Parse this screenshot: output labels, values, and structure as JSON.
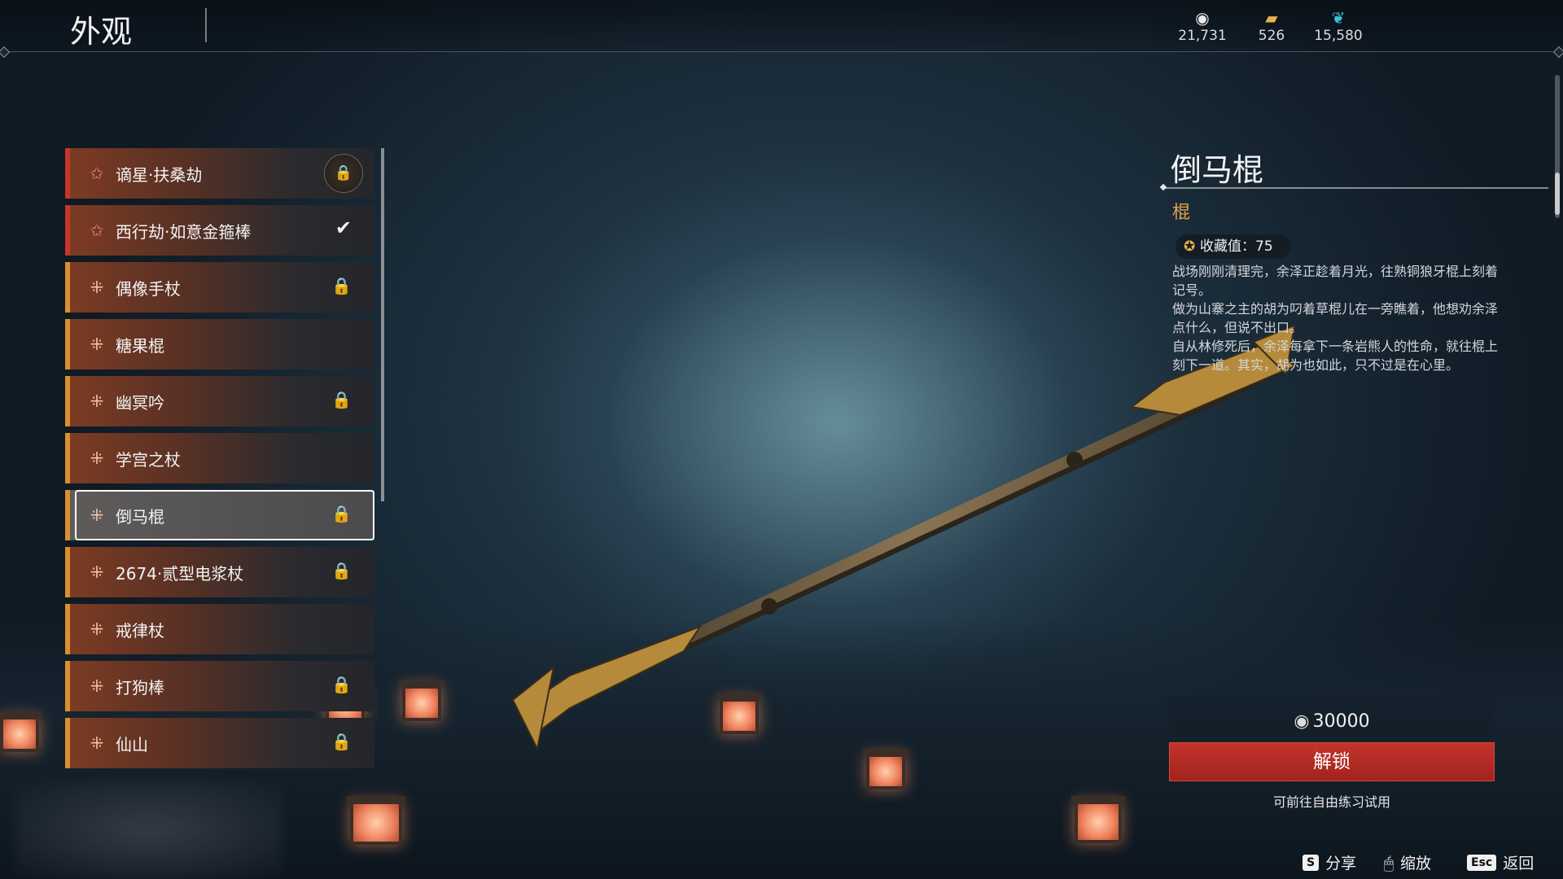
{
  "header": {
    "title": "外观",
    "currencies": [
      {
        "icon": "coin-icon",
        "value": "21,731"
      },
      {
        "icon": "gold-bar-icon",
        "value": "526"
      },
      {
        "icon": "feather-gem-icon",
        "value": "15,580"
      }
    ]
  },
  "list": {
    "items": [
      {
        "label": "谪星·扶桑劫",
        "status": "lock-badge"
      },
      {
        "label": "西行劫·如意金箍棒",
        "status": "equipped-check"
      },
      {
        "label": "偶像手杖",
        "status": "lock"
      },
      {
        "label": "糖果棍",
        "status": ""
      },
      {
        "label": "幽冥吟",
        "status": "lock"
      },
      {
        "label": "学宫之杖",
        "status": ""
      },
      {
        "label": "倒马棍",
        "status": "lock"
      },
      {
        "label": "2674·贰型电浆杖",
        "status": "lock"
      },
      {
        "label": "戒律杖",
        "status": ""
      },
      {
        "label": "打狗棒",
        "status": "lock"
      },
      {
        "label": "仙山",
        "status": "lock"
      }
    ]
  },
  "detail": {
    "name": "倒马棍",
    "type": "棍",
    "collection_label": "收藏值：75",
    "description": [
      "战场刚刚清理完，余泽正趁着月光，往熟铜狼牙棍上刻着记号。",
      "做为山寨之主的胡为叼着草棍儿在一旁瞧着，他想劝余泽点什么，但说不出口。",
      "自从林修死后，余泽每拿下一条岩熊人的性命，就往棍上刻下一道。其实，胡为也如此，只不过是在心里。"
    ],
    "price": "30000",
    "unlock_label": "解锁",
    "hint": "可前往自由练习试用"
  },
  "footer": {
    "share_key": "S",
    "share_label": "分享",
    "zoom_label": "缩放",
    "back_key": "Esc",
    "back_label": "返回"
  },
  "colors": {
    "accent_orange": "#d9902e",
    "accent_red": "#c8362b",
    "unlock_button": "#b02a23",
    "type_label": "#e0a24b"
  }
}
